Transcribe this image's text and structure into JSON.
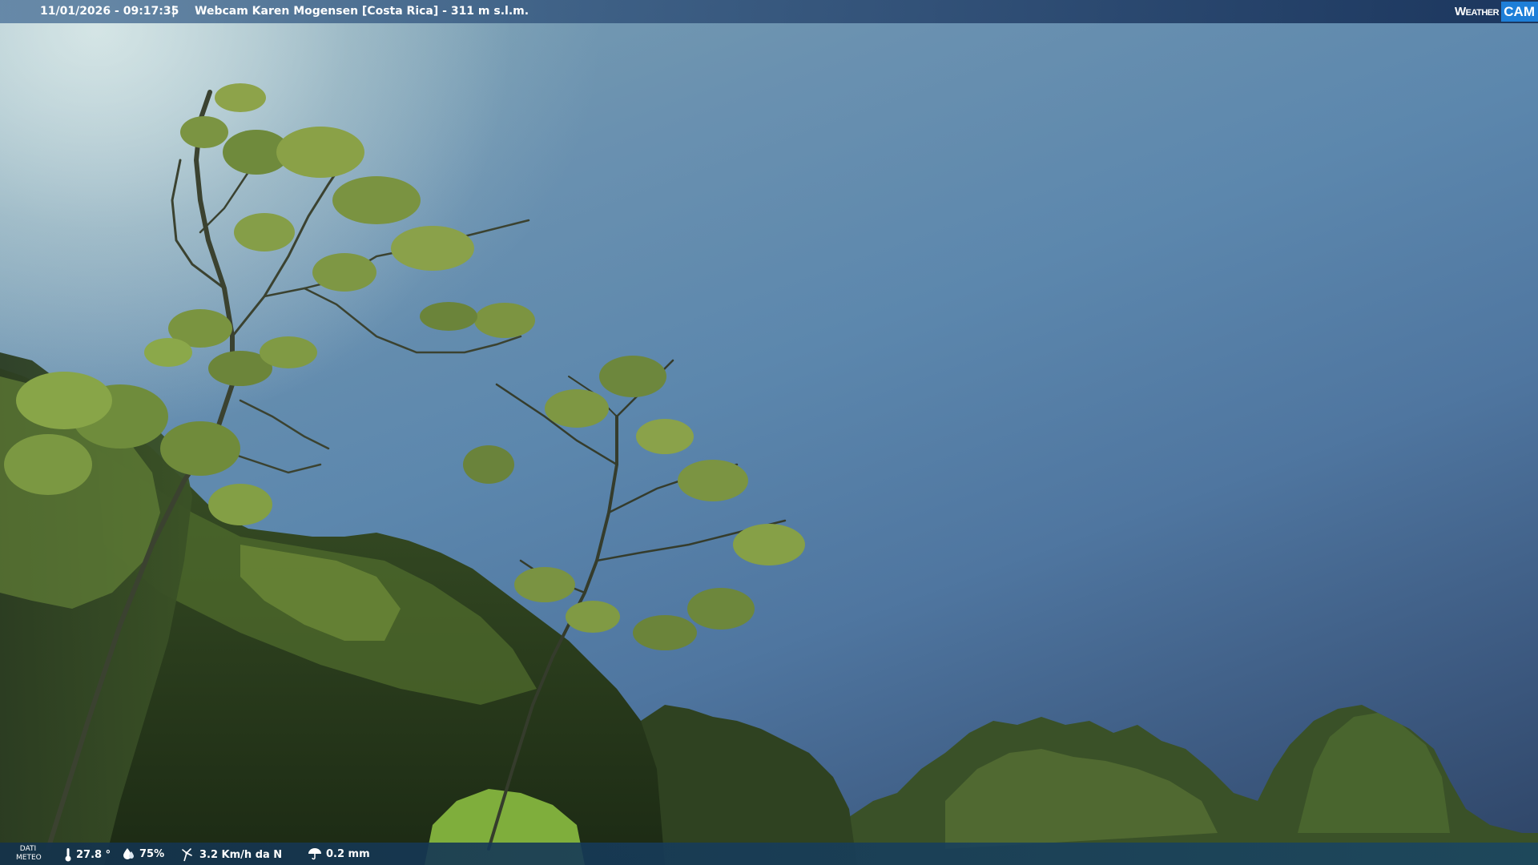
{
  "header": {
    "datetime": "11/01/2026 - 09:17:35",
    "separator": "|",
    "title": "Webcam Karen Mogensen [Costa Rica] - 311 m s.l.m."
  },
  "logo": {
    "weather": "Weather",
    "cam": "CAM"
  },
  "weather_bar": {
    "label_line1": "DATI",
    "label_line2": "METEO",
    "temperature": "27.8 °",
    "humidity": "75%",
    "wind": "3.2 Km/h da N",
    "rain": "0.2 mm"
  },
  "icons": {
    "temperature": "thermometer-icon",
    "humidity": "humidity-drop-icon",
    "wind": "wind-icon",
    "rain": "rain-umbrella-icon",
    "logo": "globe-icon"
  },
  "colors": {
    "sky_light": "#7fa3b3",
    "sky_dark": "#2e4466",
    "foliage_dark": "#1e2a18",
    "foliage_light": "#8fa84a",
    "logo_accent": "#1e7fd8"
  }
}
